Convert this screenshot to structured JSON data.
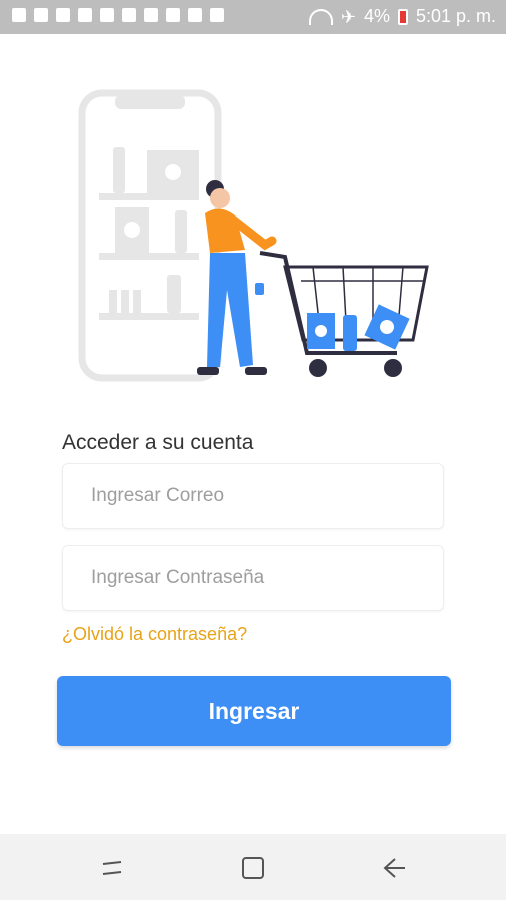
{
  "status_bar": {
    "battery": "4%",
    "time": "5:01 p. m.",
    "icons": [
      "alert-icon",
      "b-icon",
      "alert-icon",
      "missed-call-icon",
      "mail-icon",
      "image-icon",
      "mail-icon",
      "warning-icon",
      "warning-icon",
      "image-icon"
    ]
  },
  "login": {
    "title": "Acceder a su cuenta",
    "email_placeholder": "Ingresar Correo",
    "password_placeholder": "Ingresar Contraseña",
    "forgot_label": "¿Olvidó la contraseña?",
    "submit_label": "Ingresar"
  },
  "colors": {
    "accent": "#3d8ef5",
    "link": "#e8a317",
    "illustration_orange": "#f7931e",
    "illustration_blue": "#3d8ef5"
  },
  "navbar": {
    "icons": [
      "recent-apps-icon",
      "home-icon",
      "back-icon"
    ]
  }
}
